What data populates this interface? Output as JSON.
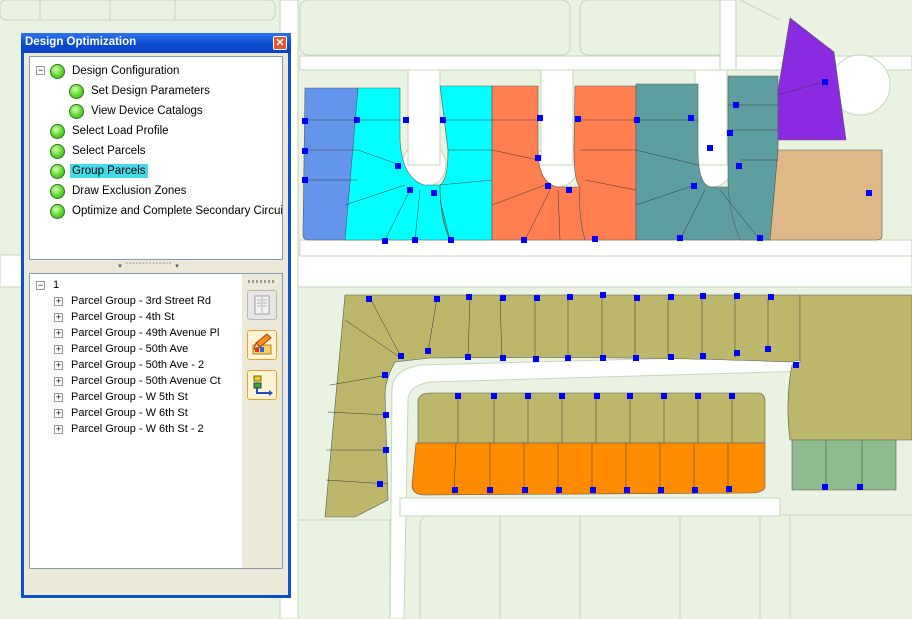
{
  "window": {
    "title": "Design Optimization",
    "close_label": "✕"
  },
  "workflow": [
    {
      "label": "Design Configuration",
      "level": 0,
      "expandable": true,
      "expander": "−",
      "selected": false
    },
    {
      "label": "Set Design Parameters",
      "level": 1,
      "expandable": false,
      "selected": false
    },
    {
      "label": "View Device Catalogs",
      "level": 1,
      "expandable": false,
      "selected": false
    },
    {
      "label": "Select Load Profile",
      "level": 0,
      "expandable": false,
      "selected": false
    },
    {
      "label": "Select Parcels",
      "level": 0,
      "expandable": false,
      "selected": false
    },
    {
      "label": "Group Parcels",
      "level": 0,
      "expandable": false,
      "selected": true
    },
    {
      "label": "Draw Exclusion Zones",
      "level": 0,
      "expandable": false,
      "selected": false
    },
    {
      "label": "Optimize and Complete Secondary Circuits",
      "level": 0,
      "expandable": false,
      "selected": false
    }
  ],
  "splitter_glyph": "▾ ˇˇˇˇˇˇˇˇˇˇˇˇˇˇ ▾",
  "groups_tree": {
    "root": {
      "label": "1",
      "expander": "−"
    },
    "items": [
      {
        "label": "Parcel Group - 3rd Street Rd"
      },
      {
        "label": "Parcel Group - 4th St"
      },
      {
        "label": "Parcel Group - 49th Avenue Pl"
      },
      {
        "label": "Parcel Group - 50th Ave"
      },
      {
        "label": "Parcel Group - 50th Ave - 2"
      },
      {
        "label": "Parcel Group - 50th Avenue Ct"
      },
      {
        "label": "Parcel Group - W 5th St"
      },
      {
        "label": "Parcel Group - W 6th St"
      },
      {
        "label": "Parcel Group - W 6th St - 2"
      }
    ],
    "item_expander": "+"
  },
  "toolbar": {
    "buttons": [
      {
        "name": "properties-button",
        "icon": "document-icon",
        "enabled": false
      },
      {
        "name": "color-groups-button",
        "icon": "pencil-palette-icon",
        "enabled": true
      },
      {
        "name": "route-button",
        "icon": "route-icon",
        "enabled": true
      }
    ]
  },
  "map_colors": {
    "background": "#eaf2e1",
    "road": "#ffffff",
    "blue_group": "#6495ed",
    "cyan_group": "#00ffff",
    "salmon_group": "#ff7f50",
    "teal_group": "#5f9ea0",
    "purple_group": "#8a2be2",
    "tan_group": "#deb887",
    "olive_group": "#bdb76b",
    "orange_group": "#ff8c00",
    "green_group": "#8fbc8f",
    "marker": "#0000ff"
  }
}
